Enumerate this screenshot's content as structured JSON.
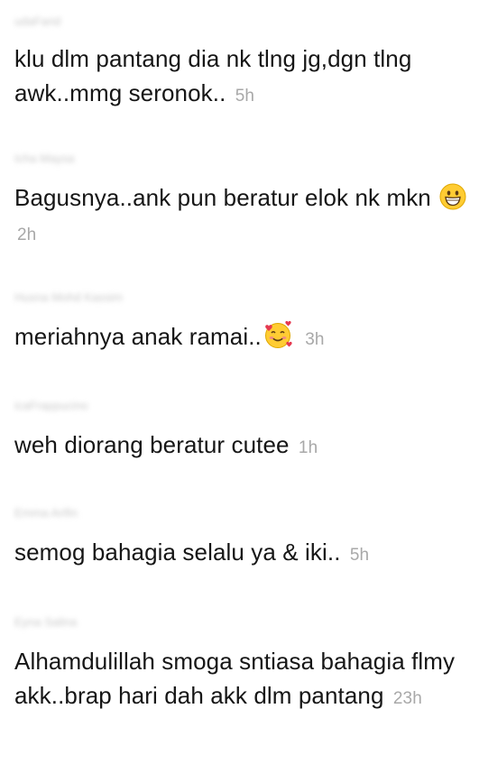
{
  "comments": [
    {
      "username": "udaFarid",
      "text": "klu dlm pantang dia nk tlng jg,dgn tlng awk..mmg seronok..",
      "time": "5h",
      "emoji": "grinning-squint-icon"
    },
    {
      "username": "Icha Maysa",
      "text": "Bagusnya..ank pun beratur elok nk mkn",
      "time": "2h",
      "emoji": "smiley-icon"
    },
    {
      "username": "Husna Mohd Kassim",
      "text": "meriahnya anak ramai..",
      "time": "3h",
      "emoji": "smiling-face-with-hearts-icon"
    },
    {
      "username": "icaFrappucino",
      "text": "weh diorang beratur cutee",
      "time": "1h"
    },
    {
      "username": "Emma Arifin",
      "text": "semog bahagia selalu ya & iki..",
      "time": "5h"
    },
    {
      "username": "Eyna Salina",
      "text": "Alhamdulillah smoga sntiasa bahagia flmy akk..brap hari dah akk dlm pantang",
      "time": "23h"
    }
  ]
}
